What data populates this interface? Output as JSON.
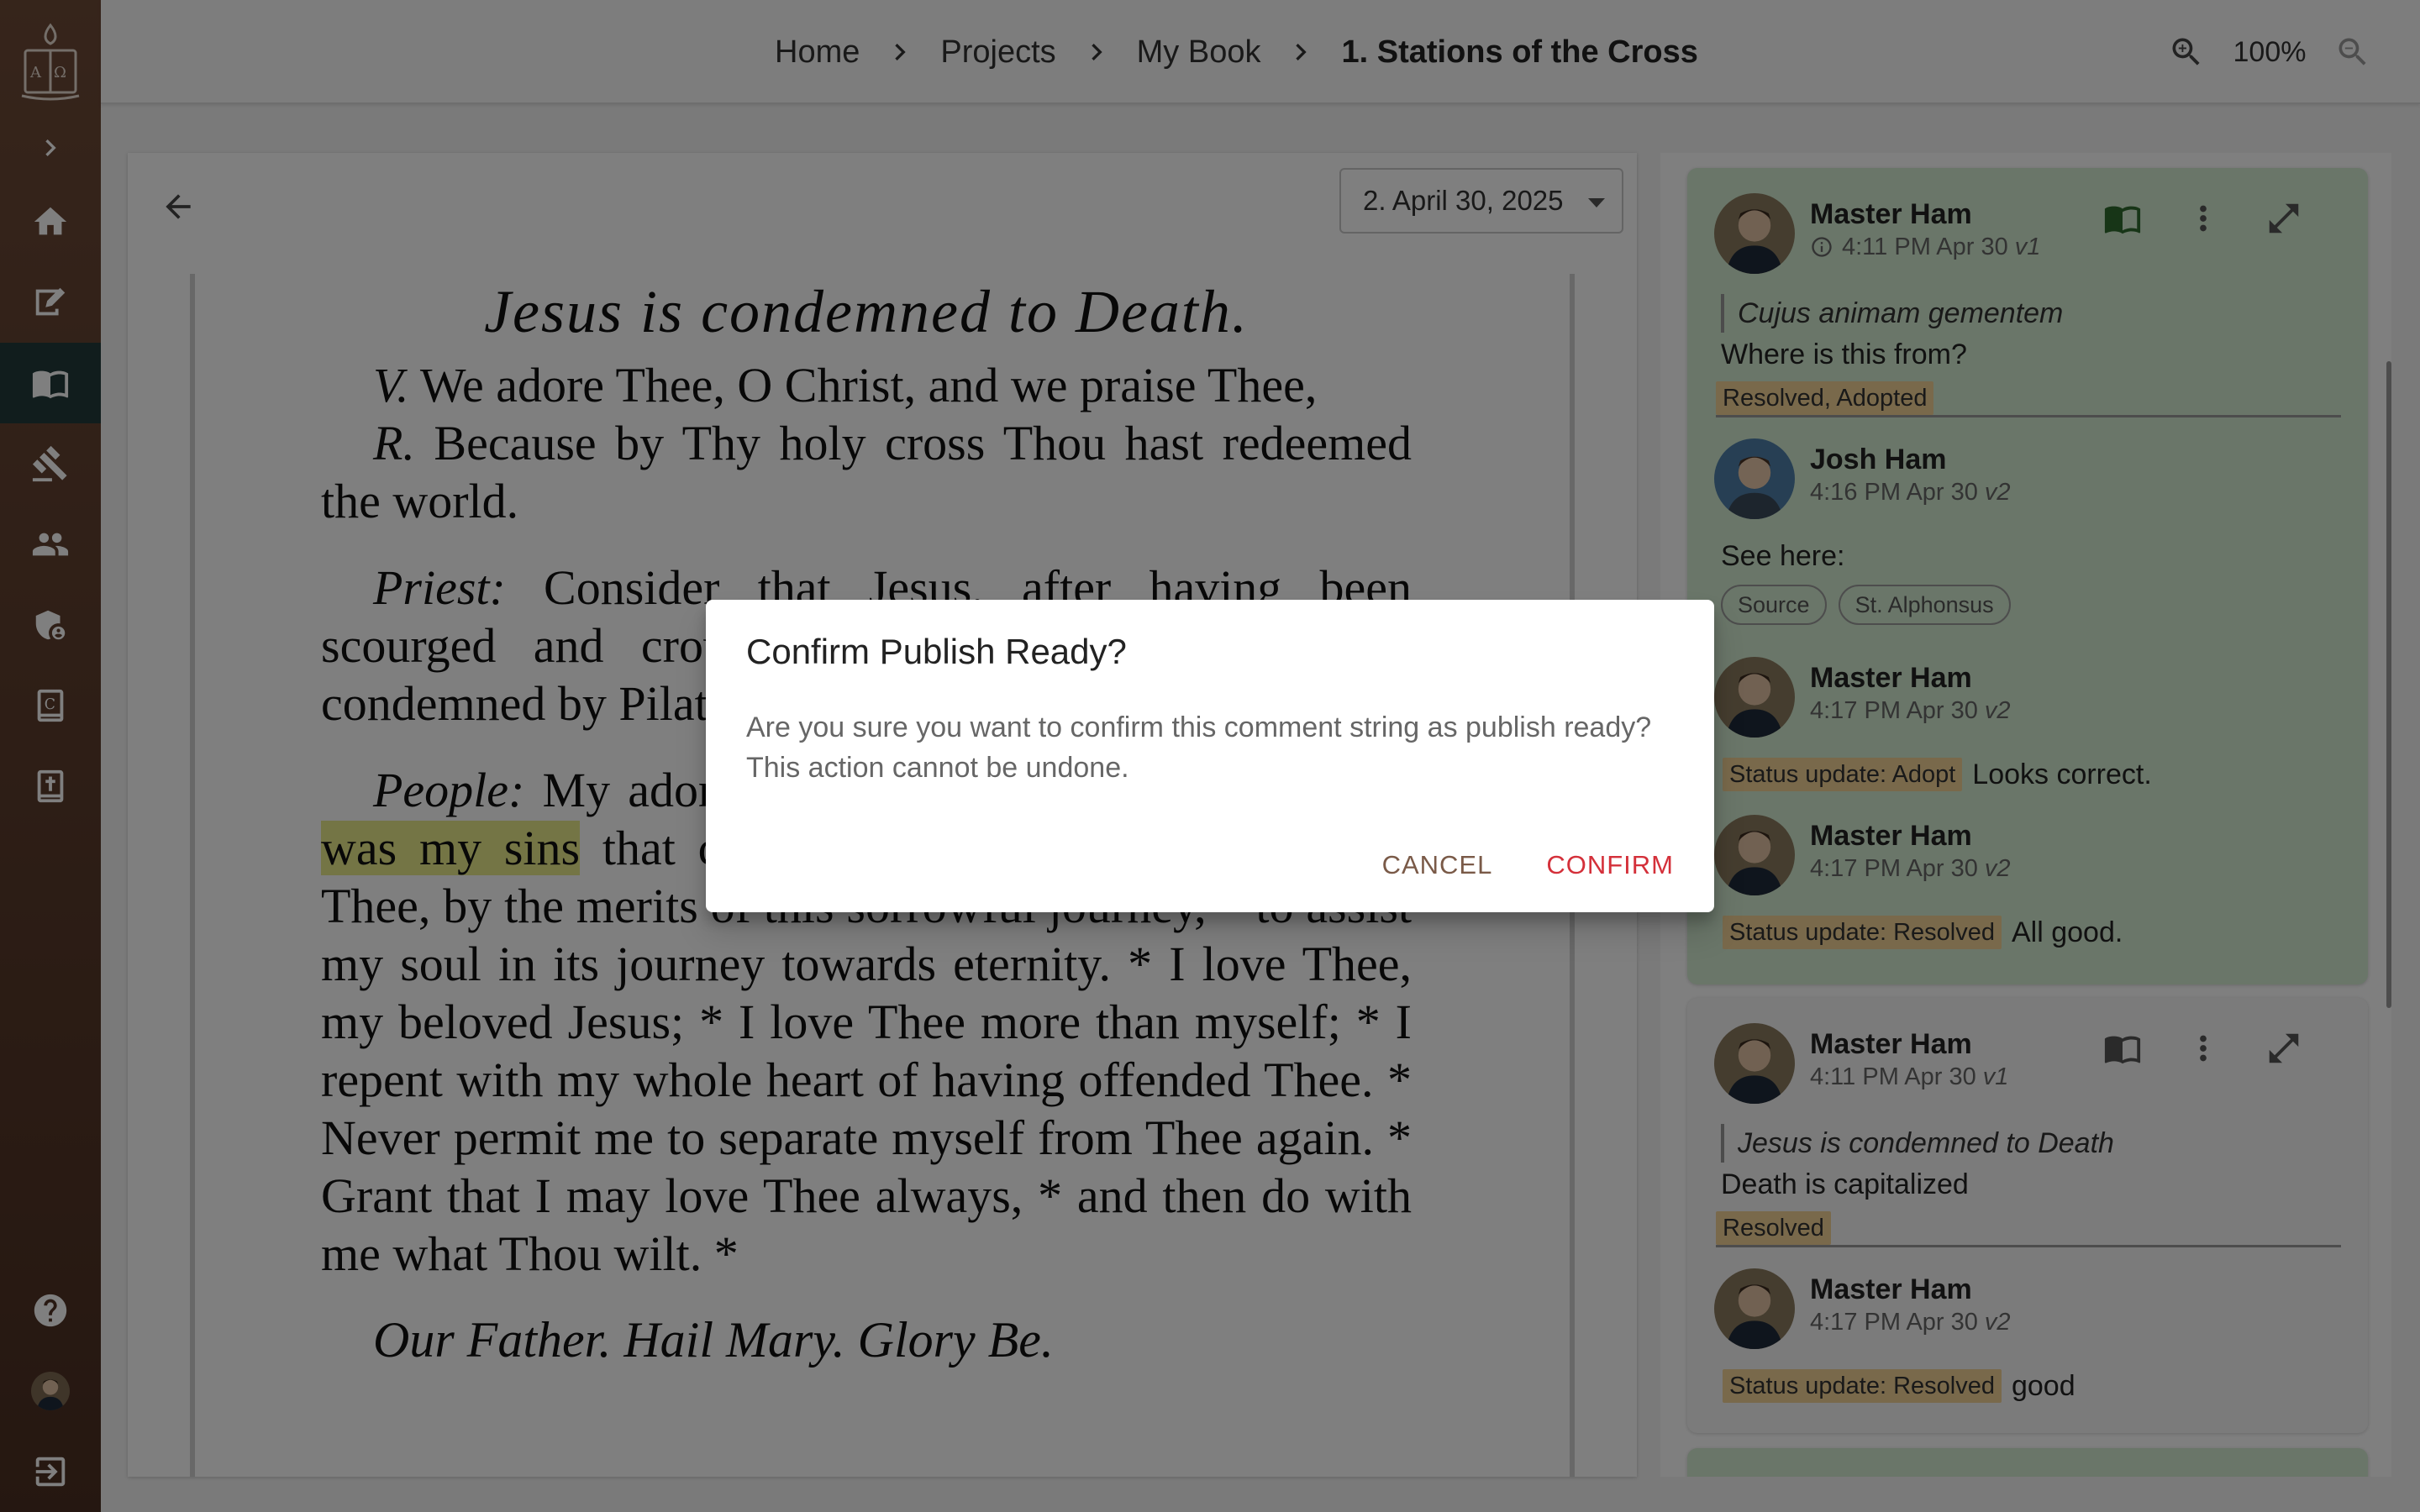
{
  "breadcrumb": {
    "items": [
      "Home",
      "Projects",
      "My Book",
      "1. Stations of the Cross"
    ]
  },
  "zoom": {
    "level": "100%"
  },
  "version_select": {
    "value": "2. April 30, 2025"
  },
  "document": {
    "title": "Jesus is condemned to Death.",
    "p1_l1_prefix": "V.",
    "p1_l1_text": " We adore Thee, O Christ, and we praise Thee,",
    "p1_l2_prefix": "R.",
    "p1_l2_text": " Because by Thy holy cross Thou hast redeemed the world.",
    "p2_prefix": "Priest:",
    "p2_text": " Consider that Jesus, after having been scourged and crowned with thorns, was unjustly condemned by Pilate to die on the cross.",
    "p3_prefix": "People:",
    "p3_text_a": " My adorable Jesus, it was not Pilate,",
    "p3_highlight": "no, it was my sins",
    "p3_text_b": " that condemned Thee to die. I beseech Thee, by the merits of this sorrowful journey, * to assist my soul in its journey towards eternity. * I love Thee, my beloved Jesus; * I love Thee more than myself; * I repent with my whole heart of having offended Thee. * Never permit me to separate myself from Thee again. * Grant that I may love Thee always, * and then do with me what Thou wilt. *",
    "closing": "Our Father. Hail Mary. Glory Be."
  },
  "comments": {
    "card1": {
      "c1": {
        "name": "Master Ham",
        "time": "4:11 PM Apr 30",
        "version": "v1",
        "quote": "Cujus animam gementem",
        "body": "Where is this from?",
        "tags": "Resolved, Adopted"
      },
      "c2": {
        "name": "Josh Ham",
        "time": "4:16 PM Apr 30",
        "version": "v2",
        "body": "See here:",
        "chips": [
          "Source",
          "St. Alphonsus"
        ]
      },
      "c3": {
        "name": "Master Ham",
        "time": "4:17 PM Apr 30",
        "version": "v2",
        "status": "Status update: Adopt",
        "body": "Looks correct."
      },
      "c4": {
        "name": "Master Ham",
        "time": "4:17 PM Apr 30",
        "version": "v2",
        "status": "Status update: Resolved",
        "body": "All good."
      }
    },
    "card2": {
      "c1": {
        "name": "Master Ham",
        "time": "4:11 PM Apr 30",
        "version": "v1",
        "quote": "Jesus is condemned to Death",
        "body": "Death is capitalized",
        "tags": "Resolved"
      },
      "c2": {
        "name": "Master Ham",
        "time": "4:17 PM Apr 30",
        "version": "v2",
        "status": "Status update: Resolved",
        "body": "good"
      }
    }
  },
  "dialog": {
    "title": "Confirm Publish Ready?",
    "body": "Are you sure you want to confirm this comment string as publish ready? This action cannot be undone.",
    "cancel": "CANCEL",
    "confirm": "CONFIRM"
  },
  "colors": {
    "sidebar_top": "#6d4a37",
    "sidebar_active": "#223a3a",
    "card_green": "#d4ecd2",
    "status_tag": "#f3d296",
    "highlight": "#e8ea8a",
    "confirm": "#d4303a",
    "cancel": "#7a5a48"
  }
}
